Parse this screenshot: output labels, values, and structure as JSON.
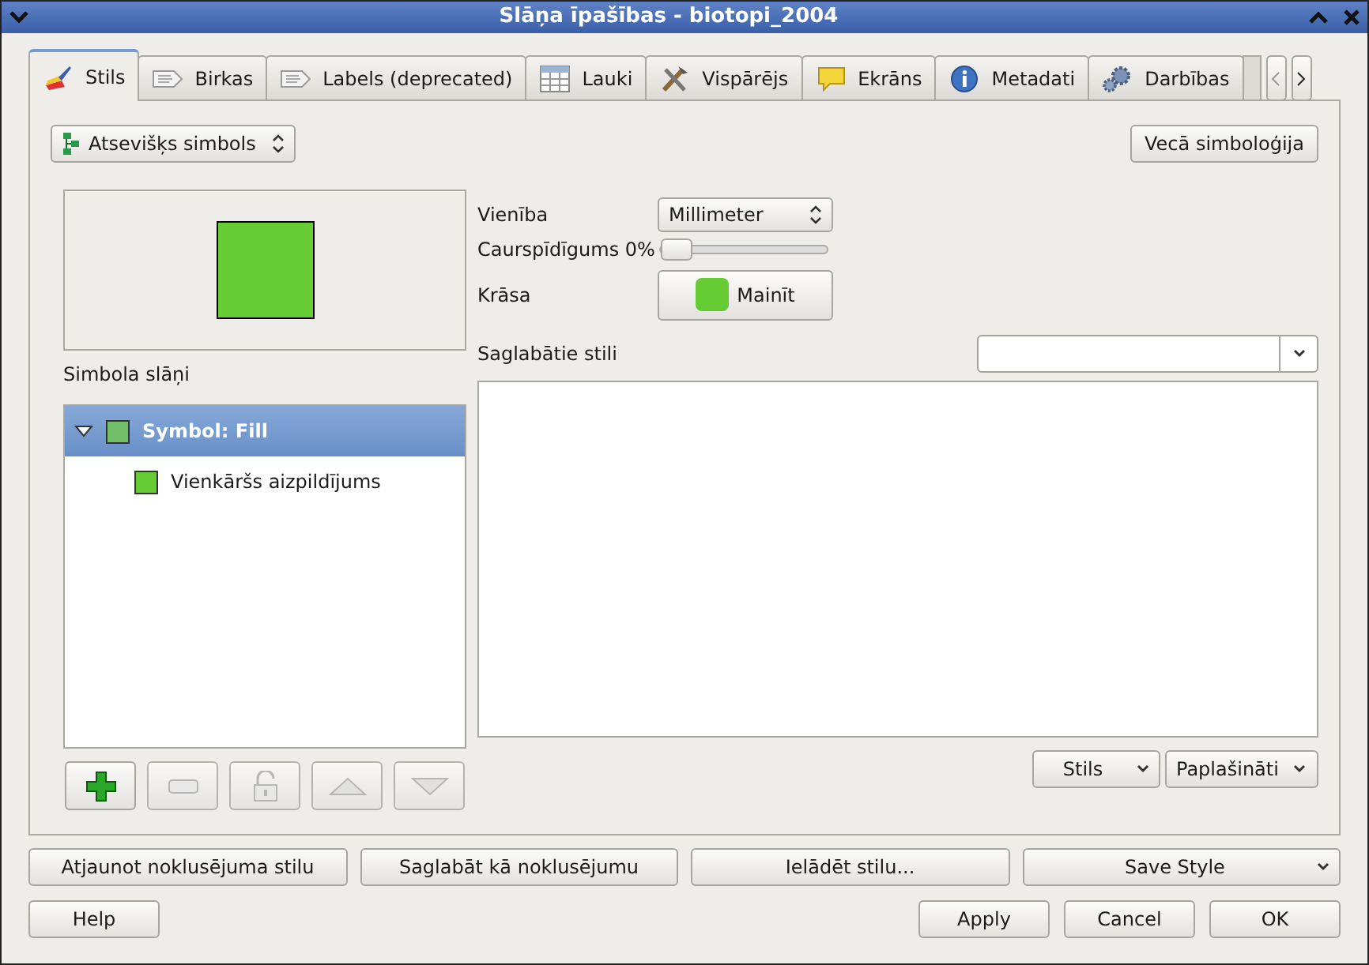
{
  "window": {
    "title": "Slāņa īpašības - biotopi_2004"
  },
  "tabs": [
    {
      "label": "Stils",
      "kind": "brush",
      "selected": true
    },
    {
      "label": "Birkas",
      "kind": "label",
      "selected": false
    },
    {
      "label": "Labels (deprecated)",
      "kind": "label",
      "selected": false
    },
    {
      "label": "Lauki",
      "kind": "table",
      "selected": false
    },
    {
      "label": "Vispārējs",
      "kind": "tools",
      "selected": false
    },
    {
      "label": "Ekrāns",
      "kind": "speech",
      "selected": false
    },
    {
      "label": "Metadati",
      "kind": "info",
      "selected": false
    },
    {
      "label": "Darbības",
      "kind": "gears",
      "selected": false
    }
  ],
  "renderer": {
    "value": "Atsevišķs simbols"
  },
  "old_symbology_button": "Vecā simboloģija",
  "symbol_layers": {
    "label": "Simbola slāņi",
    "tree": [
      {
        "label": "Symbol: Fill",
        "color": "#72bf6a",
        "selected": true,
        "expanded": true,
        "children": [
          {
            "label": "Vienkāršs aizpildījums",
            "color": "#66cc33",
            "selected": false
          }
        ]
      }
    ]
  },
  "layer_buttons": [
    {
      "kind": "add",
      "disabled": false
    },
    {
      "kind": "remove",
      "disabled": true
    },
    {
      "kind": "lock",
      "disabled": true
    },
    {
      "kind": "up",
      "disabled": true
    },
    {
      "kind": "down",
      "disabled": true
    }
  ],
  "properties": {
    "unit_label": "Vienība",
    "unit_value": "Millimeter",
    "transparency_label": "Caurspīdīgums 0%",
    "transparency": {
      "level": 0
    },
    "color_label": "Krāsa",
    "color": "#66cc33",
    "color_button": "Mainīt"
  },
  "saved_styles": {
    "label": "Saglabātie stili"
  },
  "style_menus": [
    "Stils",
    "Paplašināti"
  ],
  "action_buttons": [
    {
      "label": "Atjaunot noklusējuma stilu",
      "kind": "button"
    },
    {
      "label": "Saglabāt kā noklusējumu",
      "kind": "button"
    },
    {
      "label": "Ielādēt stilu...",
      "kind": "button"
    },
    {
      "label": "Save Style",
      "kind": "menu"
    }
  ],
  "dialog_buttons": {
    "help": "Help",
    "right": [
      "Apply",
      "Cancel",
      "OK"
    ]
  }
}
